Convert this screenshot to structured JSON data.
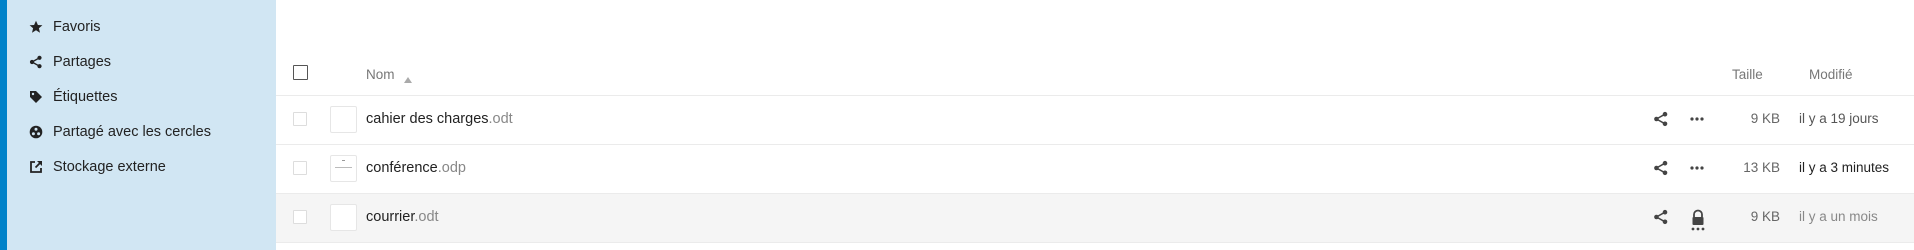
{
  "sidebar": {
    "items": [
      {
        "label": "Favoris",
        "icon": "star-icon"
      },
      {
        "label": "Partages",
        "icon": "share-icon"
      },
      {
        "label": "Étiquettes",
        "icon": "tag-icon"
      },
      {
        "label": "Partagé avec les cercles",
        "icon": "circles-icon"
      },
      {
        "label": "Stockage externe",
        "icon": "external-link-icon"
      }
    ]
  },
  "table": {
    "headers": {
      "name": "Nom",
      "size": "Taille",
      "modified": "Modifié"
    },
    "sort": "ascending",
    "rows": [
      {
        "name": "cahier des charges",
        "ext": ".odt",
        "size": "9 KB",
        "modified": "il y a 19 jours"
      },
      {
        "name": "conférence",
        "ext": ".odp",
        "size": "13 KB",
        "modified": "il y a 3 minutes"
      },
      {
        "name": "courrier",
        "ext": ".odt",
        "size": "9 KB",
        "modified": "il y a un mois"
      }
    ]
  },
  "colors": {
    "accent": "#0082c9",
    "sidebar_bg": "#d1e6f3",
    "row_highlight": "#f5f5f5"
  }
}
